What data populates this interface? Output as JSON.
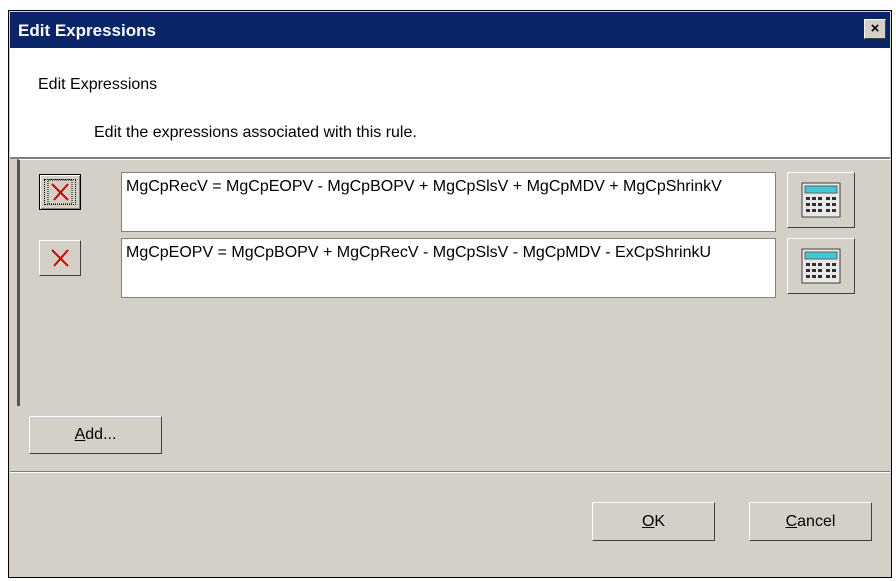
{
  "window": {
    "title": "Edit Expressions",
    "close_label": "×"
  },
  "header": {
    "title": "Edit Expressions",
    "subtitle": "Edit the expressions associated with this rule."
  },
  "expressions": [
    {
      "text": "MgCpRecV = MgCpEOPV - MgCpBOPV + MgCpSlsV + MgCpMDV + MgCpShrinkV",
      "delete_icon": "delete-x-icon",
      "calc_icon": "calculator-icon"
    },
    {
      "text": "MgCpEOPV = MgCpBOPV + MgCpRecV - MgCpSlsV - MgCpMDV - ExCpShrinkU",
      "delete_icon": "delete-x-icon",
      "calc_icon": "calculator-icon"
    }
  ],
  "buttons": {
    "add": {
      "mnemonic": "A",
      "rest": "dd..."
    },
    "ok": {
      "mnemonic": "O",
      "rest": "K"
    },
    "cancel": {
      "mnemonic": "C",
      "rest": "ancel"
    }
  },
  "colors": {
    "titlebar": "#0a246a",
    "face": "#d4d0c8",
    "delete_x": "#cc0000",
    "calc_display": "#40c8d8"
  }
}
